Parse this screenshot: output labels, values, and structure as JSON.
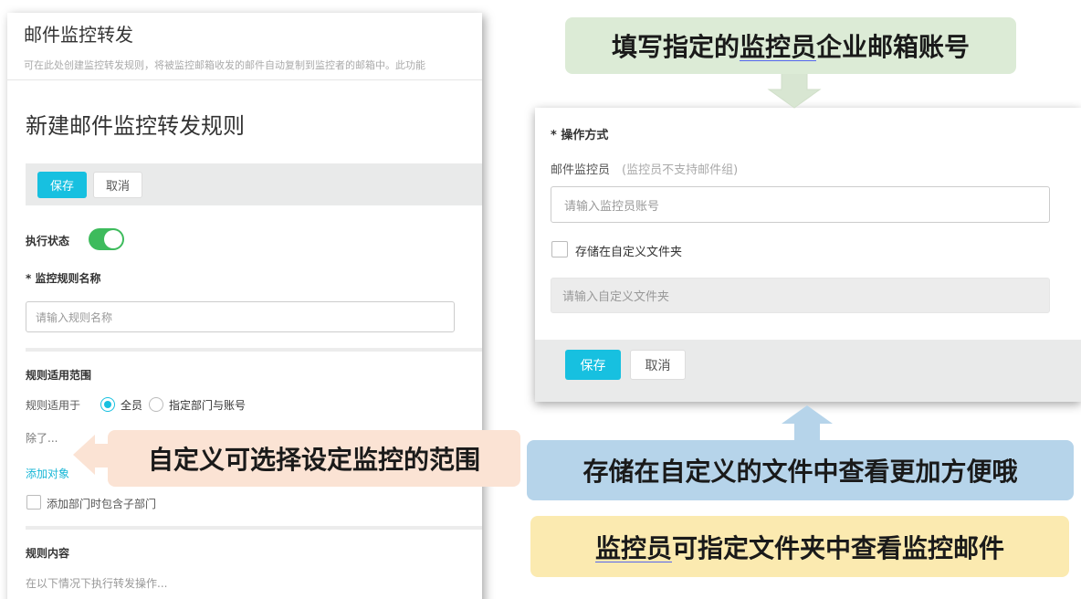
{
  "left_panel": {
    "title": "邮件监控转发",
    "description": "可在此处创建监控转发规则，将被监控邮箱收发的邮件自动复制到监控者的邮箱中。此功能",
    "form_title": "新建邮件监控转发规则",
    "save_label": "保存",
    "cancel_label": "取消",
    "status_label": "执行状态",
    "status_on": true,
    "rule_name_label": "* 监控规则名称",
    "rule_name_placeholder": "请输入规则名称",
    "scope_section": "规则适用范围",
    "applies_to_label": "规则适用于",
    "option_all": "全员",
    "option_specific": "指定部门与账号",
    "selected_option": "全员",
    "except_label": "除了...",
    "add_target": "添加对象",
    "include_subdept": "添加部门时包含子部门",
    "content_section": "规则内容",
    "content_hint": "在以下情况下执行转发操作..."
  },
  "right_panel": {
    "operation_label": "* 操作方式",
    "monitor_label": "邮件监控员",
    "monitor_note": "(监控员不支持邮件组)",
    "monitor_placeholder": "请输入监控员账号",
    "store_folder_label": "存储在自定义文件夹",
    "folder_placeholder": "请输入自定义文件夹",
    "save_label": "保存",
    "cancel_label": "取消"
  },
  "callouts": {
    "top_prefix": "填写指定的",
    "top_highlight": "监控员",
    "top_suffix": "企业邮箱账号",
    "left": "自定义可选择设定监控的范围",
    "blue": "存储在自定义的文件中查看更加方便哦",
    "bottom_highlight": "监控员",
    "bottom_suffix": "可指定文件夹中查看监控邮件"
  },
  "colors": {
    "primary": "#17c0e0",
    "toggle_on": "#3dbb5c",
    "callout_green": "#dcebd6",
    "callout_orange": "#fbe3d4",
    "callout_blue": "#b6d4ea",
    "callout_yellow": "#fbeab0"
  }
}
